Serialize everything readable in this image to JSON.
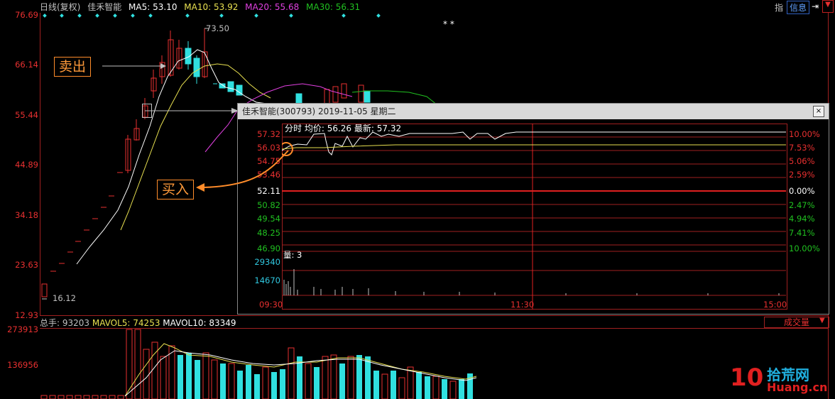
{
  "header": {
    "period": "日线(复权)",
    "stock_name": "佳禾智能",
    "ma5": "MA5: 53.10",
    "ma10": "MA10: 53.92",
    "ma20": "MA20: 55.68",
    "ma30": "MA30: 56.31",
    "btn_zhi": "指",
    "btn_info": "信息"
  },
  "colors": {
    "ma5": "#ffffff",
    "ma10": "#e8e050",
    "ma20": "#e040e0",
    "ma30": "#20c020",
    "up": "#e83030",
    "down": "#30e0e0"
  },
  "main_chart": {
    "y_labels": [
      "76.69",
      "66.14",
      "55.44",
      "44.89",
      "34.18",
      "23.63",
      "12.93"
    ],
    "high_label": "73.50",
    "low_label": "16.12",
    "stars": "* *"
  },
  "callouts": {
    "sell": "卖出",
    "buy": "买入"
  },
  "intraday": {
    "title": "佳禾智能(300793) 2019-11-05 星期二",
    "legend_fs": "分时",
    "legend_avg": "均价: 56.26",
    "legend_last": "最新: 57.32",
    "left_labels": [
      "57.32",
      "56.03",
      "54.75",
      "53.46",
      "52.11",
      "50.82",
      "49.54",
      "48.25",
      "46.90"
    ],
    "right_labels": [
      "10.00%",
      "7.53%",
      "5.06%",
      "2.59%",
      "0.00%",
      "2.47%",
      "4.94%",
      "7.41%",
      "10.00%"
    ],
    "vol_label": "量: 3",
    "vol_ticks": [
      "29340",
      "14670"
    ],
    "time_labels": [
      "09:30",
      "11:30",
      "15:00"
    ]
  },
  "volume": {
    "total": "总手: 93203",
    "mavol5": "MAVOL5: 74253",
    "mavol10": "MAVOL10: 83349",
    "y_labels": [
      "273913",
      "136956"
    ],
    "dropdown": "成交量"
  },
  "watermark": {
    "num": "10",
    "site": "Huang.cn",
    "cn": "拾荒网"
  },
  "chart_data": {
    "type": "bar",
    "categories": [],
    "values": [
      93203
    ],
    "title": "",
    "ylim": [
      0,
      273913
    ]
  }
}
